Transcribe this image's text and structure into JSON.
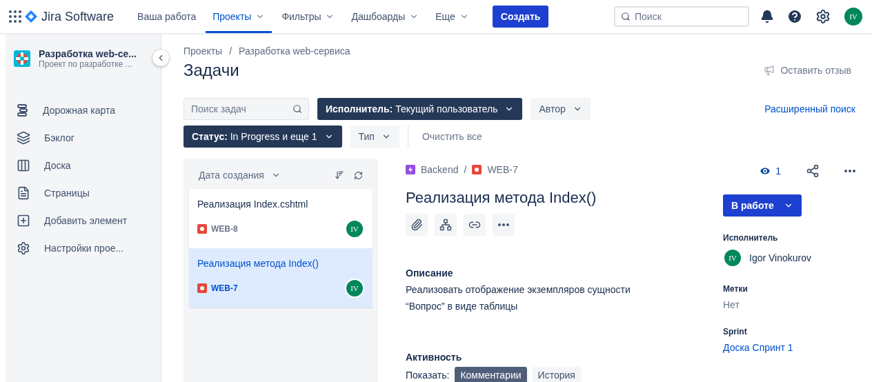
{
  "topnav": {
    "logo": "Jira Software",
    "items": [
      {
        "label": "Ваша работа",
        "selected": false,
        "menu": false
      },
      {
        "label": "Проекты",
        "selected": true,
        "menu": true
      },
      {
        "label": "Фильтры",
        "selected": false,
        "menu": true
      },
      {
        "label": "Дашбоарды",
        "selected": false,
        "menu": true
      },
      {
        "label": "Еще",
        "selected": false,
        "menu": true
      }
    ],
    "create": "Создать",
    "search": {
      "placeholder": "Поиск"
    },
    "avatar": "IV"
  },
  "sidebar": {
    "project": {
      "name": "Разработка web-се...",
      "subtitle": "Проект по разработке ..."
    },
    "items": [
      {
        "label": "Дорожная карта"
      },
      {
        "label": "Бэклог"
      },
      {
        "label": "Доска"
      },
      {
        "label": "Страницы"
      },
      {
        "label": "Добавить элемент"
      },
      {
        "label": "Настройки прое..."
      }
    ]
  },
  "breadcrumbs": {
    "separator": "/",
    "items": [
      "Проекты",
      "Разработка web-сервиса"
    ]
  },
  "title": "Задачи",
  "feedback": "Оставить отзыв",
  "advanced_search": "Расширенный поиск",
  "filter_rows": [
    [
      {
        "kind": "search",
        "placeholder": "Поиск задач"
      },
      {
        "kind": "filter",
        "label": "**Исполнитель:** Текущий пользователь",
        "active": true
      },
      {
        "kind": "filter",
        "label": "Автор",
        "active": false
      }
    ],
    [
      {
        "kind": "filter",
        "label": "**Статус:** In Progress и еще 1",
        "active": true
      },
      {
        "kind": "filter",
        "label": "Тип",
        "active": false
      },
      {
        "kind": "clear",
        "label": "Очистить все"
      }
    ]
  ],
  "issue_list": {
    "sort": "Дата создания",
    "issues": [
      {
        "title": "Реализация Index.cshtml",
        "key": "WEB-8",
        "avatar": "IV",
        "selected": false
      },
      {
        "title": "Реализация метода Index()",
        "key": "WEB-7",
        "avatar": "IV",
        "selected": true
      }
    ]
  },
  "detail": {
    "parent": "Backend",
    "separator": "/",
    "key": "WEB-7",
    "title": "Реализация метода Index()",
    "watchers": "1",
    "status": "В работе",
    "description_heading": "Описание",
    "description": "Реализовать отображение экземпляров сущности “Вопрос” в виде таблицы",
    "activity_heading": "Активность",
    "show_label": "Показать:",
    "activity_tabs": [
      {
        "label": "Комментарии",
        "selected": true
      },
      {
        "label": "История",
        "selected": false
      }
    ],
    "fields": [
      {
        "kind": "user",
        "label": "Исполнитель",
        "value": "Igor Vinokurov",
        "avatar": "IV"
      },
      {
        "kind": "text",
        "label": "Метки",
        "value": "Нет"
      },
      {
        "kind": "link",
        "label": "Sprint",
        "value": "Доска Спринт 1"
      }
    ]
  }
}
